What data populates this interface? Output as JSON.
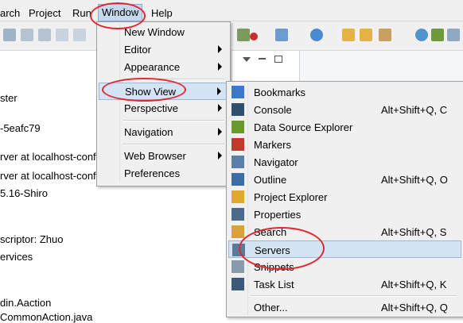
{
  "menubar": {
    "items": [
      "arch",
      "Project",
      "Run",
      "Window",
      "Help"
    ]
  },
  "workspace": {
    "lines": [
      "ster",
      "-5eafc79",
      "rver at localhost-conf",
      "rver at localhost-conf",
      "5.16-Shiro",
      "scriptor: Zhuo",
      "ervices",
      "din.Aaction",
      "CommonAction.java"
    ]
  },
  "window_menu": {
    "items": [
      {
        "label": "New Window",
        "submenu": false
      },
      {
        "label": "Editor",
        "submenu": true
      },
      {
        "label": "Appearance",
        "submenu": true
      },
      {
        "label": "Show View",
        "submenu": true
      },
      {
        "label": "Perspective",
        "submenu": true
      },
      {
        "label": "Navigation",
        "submenu": true
      },
      {
        "label": "Web Browser",
        "submenu": true
      },
      {
        "label": "Preferences",
        "submenu": false
      }
    ]
  },
  "show_view_menu": {
    "items": [
      {
        "label": "Bookmarks",
        "shortcut": "",
        "icon": "bookmark-icon",
        "color": "#3a78c9"
      },
      {
        "label": "Console",
        "shortcut": "Alt+Shift+Q, C",
        "icon": "console-icon",
        "color": "#2f4f6f"
      },
      {
        "label": "Data Source Explorer",
        "shortcut": "",
        "icon": "database-icon",
        "color": "#6a9a2c"
      },
      {
        "label": "Markers",
        "shortcut": "",
        "icon": "markers-icon",
        "color": "#c0392b"
      },
      {
        "label": "Navigator",
        "shortcut": "",
        "icon": "navigator-icon",
        "color": "#5b7fa8"
      },
      {
        "label": "Outline",
        "shortcut": "Alt+Shift+Q, O",
        "icon": "outline-icon",
        "color": "#3a6ea5"
      },
      {
        "label": "Project Explorer",
        "shortcut": "",
        "icon": "project-explorer-icon",
        "color": "#e0a82e"
      },
      {
        "label": "Properties",
        "shortcut": "",
        "icon": "properties-icon",
        "color": "#4a6b8a"
      },
      {
        "label": "Search",
        "shortcut": "Alt+Shift+Q, S",
        "icon": "search-icon",
        "color": "#d9a13b"
      },
      {
        "label": "Servers",
        "shortcut": "",
        "icon": "servers-icon",
        "color": "#5a7a9a"
      },
      {
        "label": "Snippets",
        "shortcut": "",
        "icon": "snippets-icon",
        "color": "#8a9aa8"
      },
      {
        "label": "Task List",
        "shortcut": "Alt+Shift+Q, K",
        "icon": "task-list-icon",
        "color": "#3b5a7a"
      },
      {
        "label": "Other...",
        "shortcut": "Alt+Shift+Q, Q",
        "icon": "",
        "color": ""
      }
    ]
  },
  "colors": {
    "annotation": "#e0282f",
    "highlight": "#d5e4f5"
  }
}
